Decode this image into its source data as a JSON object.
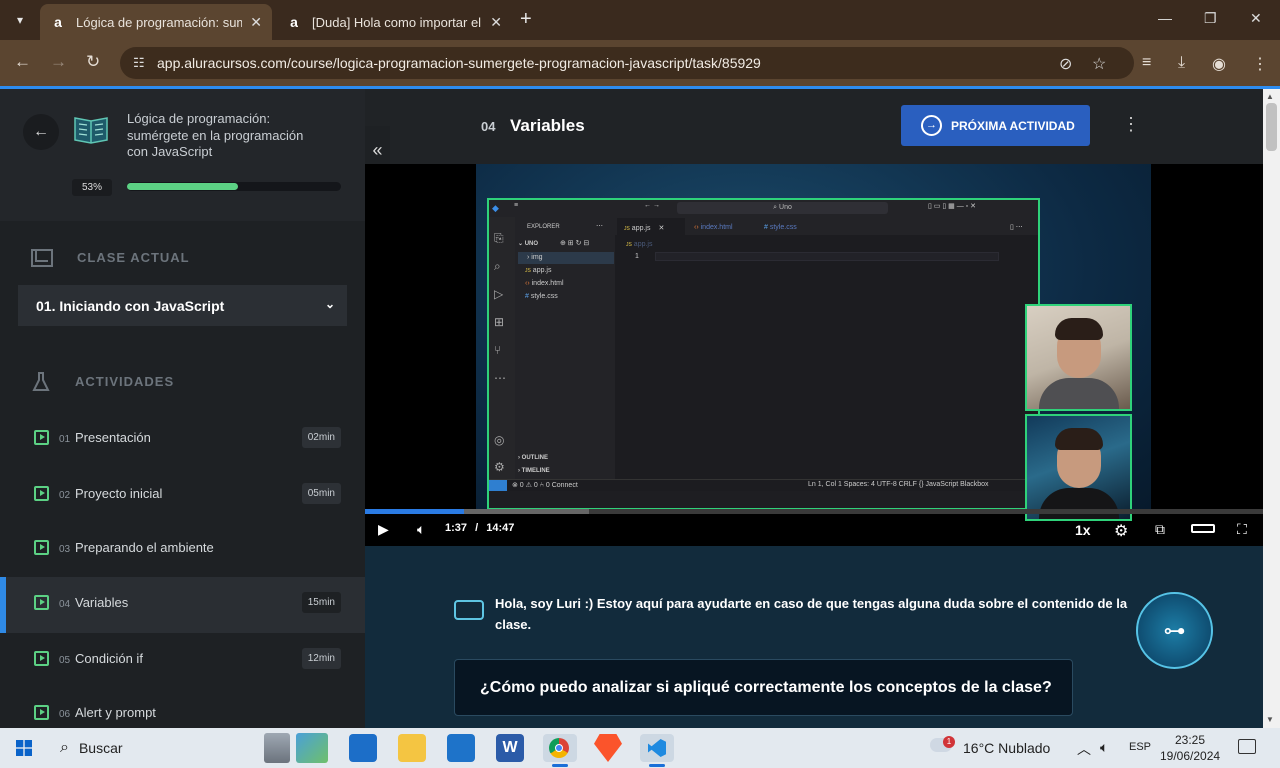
{
  "browser": {
    "tabs": [
      {
        "title": "Lógica de programación: sumé",
        "favicon": "a",
        "active": true
      },
      {
        "title": "[Duda] Hola como importar el p",
        "favicon": "a",
        "active": false
      }
    ],
    "url": "app.aluracursos.com/course/logica-programacion-sumergete-programacion-javascript/task/85929"
  },
  "sidebar": {
    "course_title": "Lógica de programación: sumérgete en la programación con JavaScript",
    "progress_label": "53%",
    "progress_value": 0.53,
    "current_class_label": "CLASE ACTUAL",
    "current_class": "01. Iniciando con JavaScript",
    "activities_label": "ACTIVIDADES",
    "activities": [
      {
        "num": "01",
        "name": "Presentación",
        "duration": "02min",
        "icon": "video-icon",
        "active": false
      },
      {
        "num": "02",
        "name": "Proyecto inicial",
        "duration": "05min",
        "icon": "video-icon",
        "active": false
      },
      {
        "num": "03",
        "name": "Preparando el ambiente",
        "duration": "",
        "icon": "checklist-icon",
        "active": false
      },
      {
        "num": "04",
        "name": "Variables",
        "duration": "15min",
        "icon": "video-icon",
        "active": true
      },
      {
        "num": "05",
        "name": "Condición if",
        "duration": "12min",
        "icon": "video-icon",
        "active": false
      },
      {
        "num": "06",
        "name": "Alert y prompt",
        "duration": "",
        "icon": "list-icon",
        "active": false
      }
    ]
  },
  "lesson": {
    "number": "04",
    "title": "Variables",
    "next_label": "PRÓXIMA ACTIVIDAD"
  },
  "video": {
    "current_time": "1:37",
    "separator": "/",
    "duration": "14:47",
    "progress": 0.11,
    "speed": "1x",
    "vscode": {
      "search": "Uno",
      "explorer_label": "EXPLORER",
      "folder": "UNO",
      "files": [
        "img",
        "app.js",
        "index.html",
        "style.css"
      ],
      "tabs": [
        "app.js",
        "index.html",
        "style.css"
      ],
      "breadcrumb": "app.js",
      "line": "1",
      "outline": "OUTLINE",
      "timeline": "TIMELINE",
      "status_left": "⊗ 0 ⚠ 0   ⑃ 0   Connect",
      "status_right": "Ln 1, Col 1   Spaces: 4   UTF-8   CRLF   {} JavaScript   Blackbox"
    }
  },
  "luri": {
    "message": "Hola, soy Luri :) Estoy aquí para ayudarte en caso de que tengas alguna duda sobre el contenido de la clase.",
    "question": "¿Cómo puedo analizar si apliqué correctamente los conceptos de la clase?"
  },
  "taskbar": {
    "search_label": "Buscar",
    "weather_badge": "1",
    "weather": "16°C  Nublado",
    "lang": "ESP",
    "time": "23:25",
    "date": "19/06/2024"
  },
  "colors": {
    "accent": "#2f8ae6",
    "progress": "#5cd184",
    "next_button": "#2a5fbf",
    "vscode_border": "#2fd27a"
  }
}
